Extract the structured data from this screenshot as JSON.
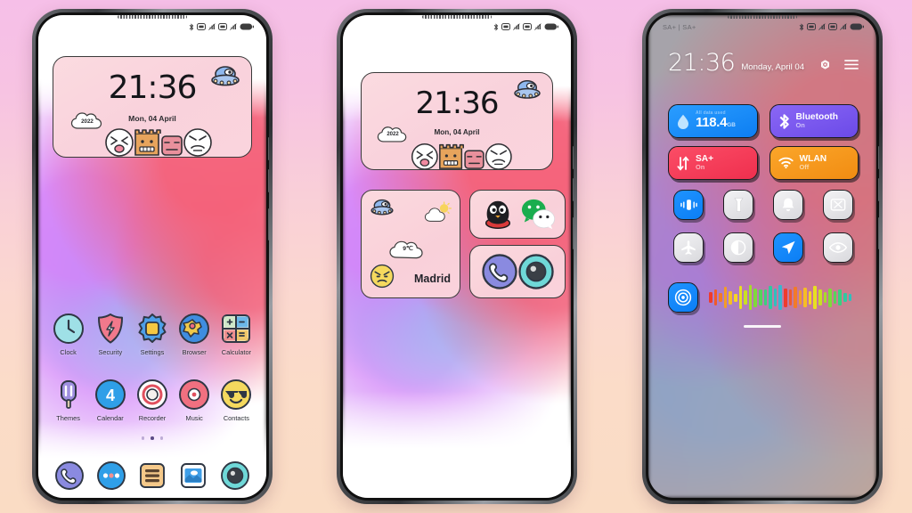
{
  "background": {
    "top_color": "#f6bfe8",
    "bottom_color": "#fadcc4"
  },
  "phones": [
    {
      "id": "phone-home-icons",
      "statusbar": {
        "left_text": "",
        "icons": [
          "bluetooth-icon",
          "sim1-icon",
          "signal1-icon",
          "sim2-icon",
          "signal2-icon",
          "battery-icon"
        ]
      },
      "clock_widget": {
        "time": "21:36",
        "date": "Mon, 04 April",
        "cloud_label": "2022",
        "decor_icons": [
          "ufo-icon",
          "cloud-icon",
          "emoji-face-1",
          "emoji-box",
          "emoji-face-2",
          "emoji-face-3"
        ]
      },
      "apps_row1": [
        {
          "label": "Clock",
          "icon": "clock-icon"
        },
        {
          "label": "Security",
          "icon": "shield-icon"
        },
        {
          "label": "Settings",
          "icon": "gear-icon"
        },
        {
          "label": "Browser",
          "icon": "globe-icon"
        },
        {
          "label": "Calculator",
          "icon": "calculator-icon"
        }
      ],
      "apps_row2": [
        {
          "label": "Themes",
          "icon": "popsicle-icon"
        },
        {
          "label": "Calendar",
          "icon": "calendar-icon",
          "day": "4"
        },
        {
          "label": "Recorder",
          "icon": "record-icon"
        },
        {
          "label": "Music",
          "icon": "vinyl-icon"
        },
        {
          "label": "Contacts",
          "icon": "sunglasses-emoji-icon"
        }
      ],
      "page_dots": {
        "count": 3,
        "active_index": 1
      },
      "dock": [
        {
          "label": "Phone",
          "icon": "phone-icon"
        },
        {
          "label": "Messages",
          "icon": "dots-bubble-icon"
        },
        {
          "label": "Notes",
          "icon": "notes-icon"
        },
        {
          "label": "Gallery",
          "icon": "gallery-icon"
        },
        {
          "label": "Camera",
          "icon": "camera-icon"
        }
      ]
    },
    {
      "id": "phone-home-widgets",
      "statusbar": {
        "left_text": "",
        "icons": [
          "bluetooth-icon",
          "sim1-icon",
          "signal1-icon",
          "sim2-icon",
          "signal2-icon",
          "battery-icon"
        ]
      },
      "clock_widget": {
        "time": "21:36",
        "date": "Mon, 04 April",
        "cloud_label": "2022",
        "decor_icons": [
          "ufo-icon",
          "emoji-face-1",
          "emoji-box",
          "emoji-face-2",
          "emoji-face-3"
        ]
      },
      "weather_widget": {
        "city": "Madrid",
        "temperature": "9℃",
        "icons": [
          "ufo-icon",
          "sun-cloud-icon",
          "angry-emoji-icon"
        ]
      },
      "social_widget": {
        "apps": [
          {
            "label": "QQ",
            "icon": "qq-penguin-icon"
          },
          {
            "label": "WeChat",
            "icon": "wechat-icon"
          }
        ]
      },
      "tools_widget": {
        "apps": [
          {
            "label": "Phone",
            "icon": "phone-icon"
          },
          {
            "label": "Camera",
            "icon": "camera-icon"
          }
        ]
      }
    },
    {
      "id": "phone-control-center",
      "statusbar": {
        "left_text": "SA+ | SA+",
        "icons": [
          "bluetooth-icon",
          "sim1-icon",
          "signal1-icon",
          "sim2-icon",
          "signal2-icon",
          "battery-icon"
        ]
      },
      "header": {
        "time": "21:36",
        "date": "Monday, April 04",
        "icons": [
          "power-icon",
          "menu-icon"
        ]
      },
      "big_tiles": [
        {
          "name": "data-usage-tile",
          "title": "118.4",
          "unit": "GB",
          "top_note": "All data used",
          "sub": "",
          "icon": "water-drop-icon",
          "color": "#1e8bff"
        },
        {
          "name": "bluetooth-tile",
          "title": "Bluetooth",
          "sub": "On",
          "icon": "bluetooth-icon",
          "color": "#7a5cf0"
        },
        {
          "name": "mobile-data-tile",
          "title": "SA+",
          "sub": "On",
          "icon": "data-arrows-icon",
          "color": "#f8415c"
        },
        {
          "name": "wlan-tile",
          "title": "WLAN",
          "sub": "Off",
          "icon": "wifi-icon",
          "color": "#f79a1e"
        }
      ],
      "small_tiles": [
        {
          "name": "vibrate-toggle",
          "icon": "vibrate-icon",
          "active": true
        },
        {
          "name": "flashlight-toggle",
          "icon": "flashlight-icon",
          "active": false
        },
        {
          "name": "silent-toggle",
          "icon": "bell-icon",
          "active": false
        },
        {
          "name": "cast-toggle",
          "icon": "cast-icon",
          "active": false
        },
        {
          "name": "airplane-toggle",
          "icon": "airplane-icon",
          "active": false
        },
        {
          "name": "brightness-toggle",
          "icon": "brightness-icon",
          "active": false
        },
        {
          "name": "location-toggle",
          "icon": "location-icon",
          "active": true
        },
        {
          "name": "reading-toggle",
          "icon": "eye-icon",
          "active": false
        }
      ],
      "bottom": {
        "tile": {
          "name": "screen-record-toggle",
          "icon": "target-icon",
          "active": true
        },
        "equalizer": {
          "name": "audio-equalizer",
          "bars": [
            40,
            62,
            35,
            78,
            50,
            30,
            88,
            55,
            96,
            70,
            62,
            58,
            86,
            64,
            92,
            70,
            60,
            78,
            55,
            72,
            50,
            84,
            62,
            40,
            70,
            46,
            58,
            34,
            24
          ],
          "colors": [
            "#ef3b2c",
            "#f05a2a",
            "#f27b28",
            "#f49c26",
            "#f6bd24",
            "#f7d522",
            "#e8e020",
            "#c9e024",
            "#a6dd28",
            "#7fd93a",
            "#56d45a",
            "#3acf7f",
            "#2fc9a0",
            "#2fc0bd",
            "#3ab6cf"
          ]
        }
      },
      "home_indicator": true
    }
  ]
}
